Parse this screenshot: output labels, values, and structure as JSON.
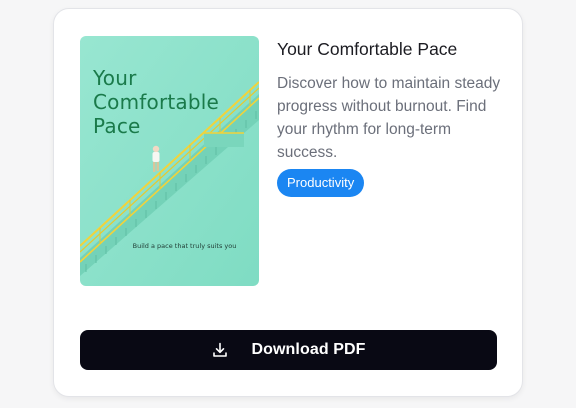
{
  "card": {
    "cover": {
      "title": "Your\nComfortable\nPace",
      "tagline": "Build a pace that truly suits you",
      "colors": {
        "background": "#8fe3cc",
        "title": "#1a7a4a",
        "rail": "#f2d33a"
      }
    },
    "title": "Your Comfortable Pace",
    "description": "Discover how to maintain steady progress without burnout. Find your rhythm for long-term success.",
    "badge": "Productivity",
    "download_label": "Download PDF",
    "colors": {
      "badge": "#1b86f2",
      "button": "#090914"
    }
  }
}
